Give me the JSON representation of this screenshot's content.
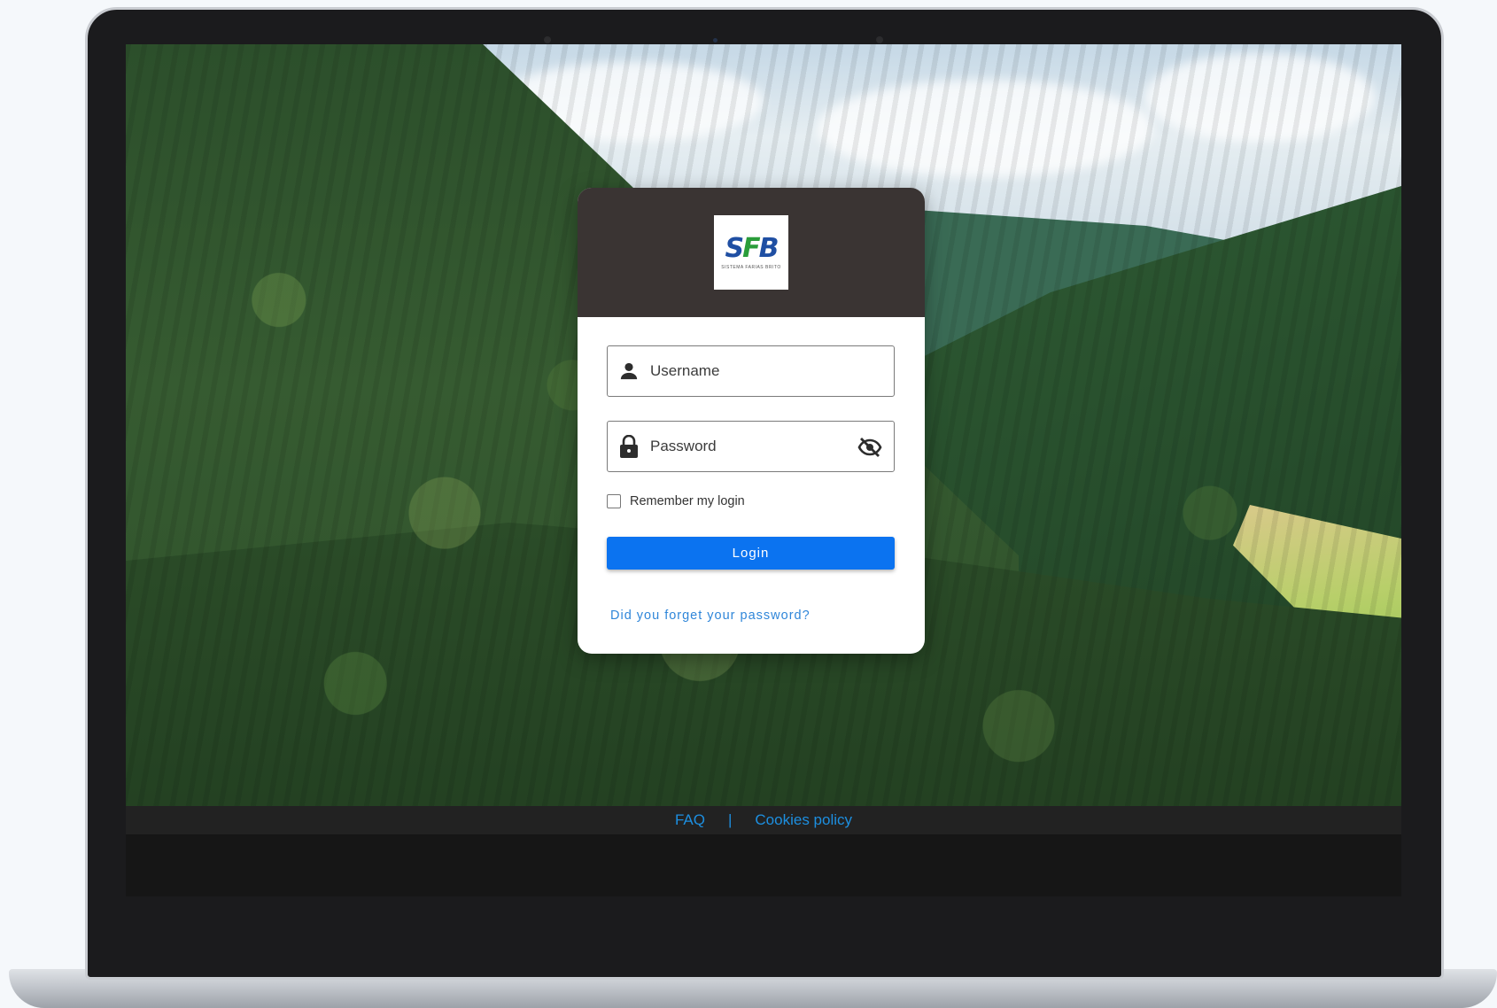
{
  "login": {
    "logo_mark_s": "S",
    "logo_mark_f": "F",
    "logo_mark_b": "B",
    "logo_subtitle": "SISTEMA FARIAS BRITO",
    "username_placeholder": "Username",
    "password_placeholder": "Password",
    "remember_label": "Remember my login",
    "login_button": "Login",
    "forgot_link": "Did you forget your password?"
  },
  "footer": {
    "faq": "FAQ",
    "separator": "|",
    "cookies": "Cookies policy"
  },
  "colors": {
    "header_bg": "#3a3433",
    "button_bg": "#0b73f0",
    "link": "#2f86d9",
    "footer_link": "#1d8fe0"
  },
  "icons": [
    "person-icon",
    "lock-icon",
    "eye-off-icon"
  ]
}
